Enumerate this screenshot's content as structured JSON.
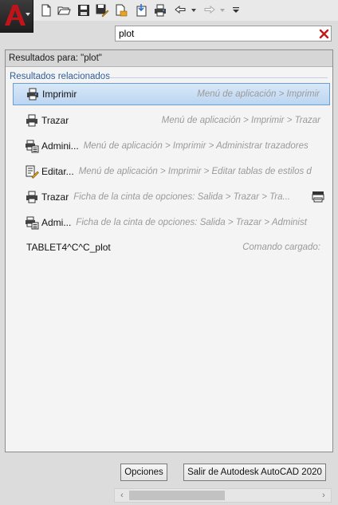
{
  "toolbar": {
    "icons": [
      "autocad-logo-icon",
      "new-icon",
      "open-icon",
      "save-icon",
      "save-as-icon",
      "open-from-web-icon",
      "save-to-web-icon",
      "plot-icon",
      "undo-icon",
      "redo-icon",
      "customize-icon"
    ]
  },
  "search": {
    "value": "plot"
  },
  "results": {
    "header": "Resultados para: \"plot\"",
    "section_title": "Resultados relacionados",
    "items": [
      {
        "label": "Imprimir",
        "path": "Menú de aplicación > Imprimir",
        "icon": "printer-icon"
      },
      {
        "label": "Trazar",
        "path": "Menú de aplicación > Imprimir > Trazar",
        "icon": "printer-icon"
      },
      {
        "label": "Admini...",
        "path": "Menú de aplicación > Imprimir > Administrar trazadores",
        "icon": "plotter-manager-icon"
      },
      {
        "label": "Editar...",
        "path": "Menú de aplicación > Imprimir > Editar tablas de estilos d",
        "icon": "edit-plot-style-icon"
      },
      {
        "label": "Trazar",
        "path": "Ficha de la cinta de opciones: Salida > Trazar > Tra...",
        "icon": "printer-icon",
        "tail_icon": "plot-panel-icon"
      },
      {
        "label": "Admi...",
        "path": "Ficha de la cinta de opciones: Salida > Trazar > Administ",
        "icon": "plotter-manager-icon"
      },
      {
        "label": "TABLET4^C^C_plot",
        "path": "Comando cargado:",
        "icon": ""
      }
    ]
  },
  "buttons": {
    "options": "Opciones",
    "exit": "Salir de Autodesk AutoCAD 2020"
  },
  "colors": {
    "accent": "#2e5d9c",
    "selection": "#bcd5f0",
    "logo_red": "#c0141b"
  }
}
